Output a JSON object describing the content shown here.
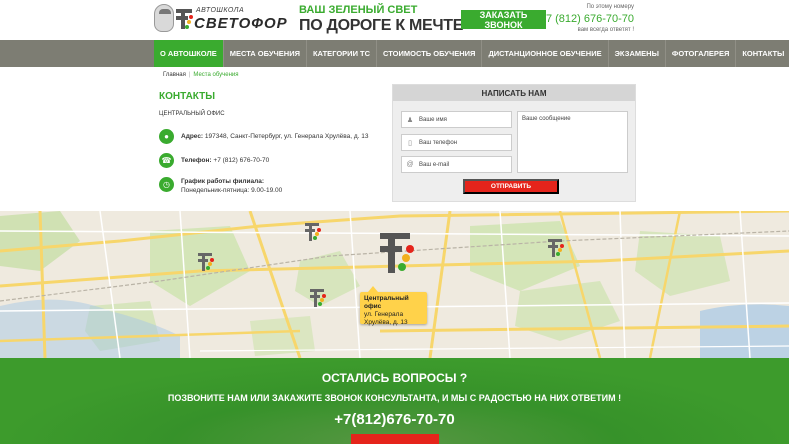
{
  "header": {
    "logo_small": "АВТОШКОЛА",
    "logo_big": "СВЕТОФОР",
    "slogan_line1": "ВАШ ЗЕЛЕНЫЙ СВЕТ",
    "slogan_line2": "ПО ДОРОГЕ К МЕЧТЕ",
    "callback_button": "ЗАКАЗАТЬ ЗВОНОК",
    "phone_note_top": "По этому номеру",
    "phone": "+7 (812) 676-70-70",
    "phone_note_bottom": "вам всегда ответят !"
  },
  "nav": {
    "items": [
      {
        "label": "О АВТОШКОЛЕ",
        "active": true
      },
      {
        "label": "МЕСТА ОБУЧЕНИЯ",
        "active": false
      },
      {
        "label": "КАТЕГОРИИ ТС",
        "active": false
      },
      {
        "label": "СТОИМОСТЬ ОБУЧЕНИЯ",
        "active": false
      },
      {
        "label": "ДИСТАНЦИОННОЕ ОБУЧЕНИЕ",
        "active": false
      },
      {
        "label": "ЭКЗАМЕНЫ",
        "active": false
      },
      {
        "label": "ФОТОГАЛЕРЕЯ",
        "active": false
      },
      {
        "label": "КОНТАКТЫ",
        "active": false
      }
    ]
  },
  "breadcrumb": {
    "home": "Главная",
    "separator": "|",
    "current": "Места обучения"
  },
  "contacts": {
    "title": "КОНТАКТЫ",
    "office": "ЦЕНТРАЛЬНЫЙ ОФИС",
    "address_label": "Адрес:",
    "address_value": "197348, Санкт-Петербург, ул. Генерала Хрулёва, д. 13",
    "phone_label": "Телефон:",
    "phone_value": "+7 (812) 676-70-70",
    "hours_label": "График работы филиала:",
    "hours_value": "Понедельник-пятница: 9.00-19.00"
  },
  "form": {
    "title": "НАПИСАТЬ НАМ",
    "name_placeholder": "Ваше имя",
    "phone_placeholder": "Ваш телефон",
    "email_placeholder": "Ваш e-mail",
    "message_placeholder": "Ваше сообщение",
    "submit": "ОТПРАВИТЬ"
  },
  "map": {
    "label_title": "Центральный офис",
    "label_line1": "ул. Генерала",
    "label_line2": "Хрулёва, д. 13"
  },
  "banner": {
    "title": "ОСТАЛИСЬ ВОПРОСЫ ?",
    "subtitle": "ПОЗВОНИТЕ НАМ ИЛИ ЗАКАЖИТЕ ЗВОНОК КОНСУЛЬТАНТА, И МЫ С РАДОСТЬЮ НА НИХ ОТВЕТИМ !",
    "phone": "+7(812)676-70-70"
  },
  "colors": {
    "brand_green": "#3aab2f",
    "nav_gray": "#7d7d73",
    "accent_red": "#e5241b",
    "label_yellow": "#ffd24a"
  }
}
